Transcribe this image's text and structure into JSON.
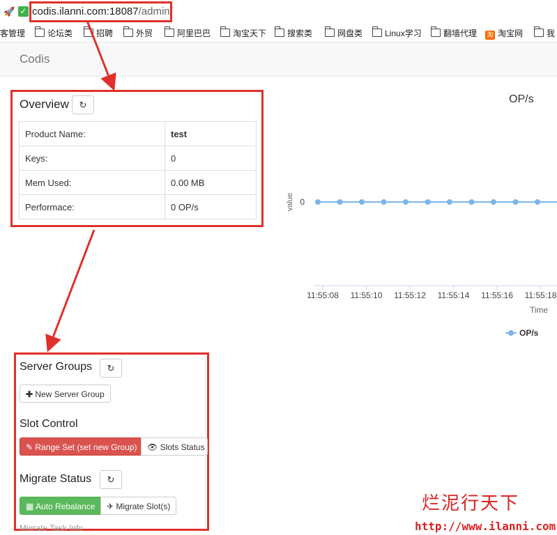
{
  "browser": {
    "url_host": "codis.ilanni.com:18087",
    "url_path": "/admin/",
    "bookmarks": [
      "客管理",
      "论坛类",
      "招聘",
      "外贸",
      "阿里巴巴",
      "淘宝天下",
      "搜索类",
      "网盘类",
      "Linux学习",
      "翻墙代理",
      "淘宝网",
      "我"
    ]
  },
  "navbar": {
    "brand": "Codis"
  },
  "overview": {
    "title": "Overview",
    "refresh_icon": "refresh-icon",
    "rows": [
      {
        "label": "Product Name:",
        "value": "test"
      },
      {
        "label": "Keys:",
        "value": "0"
      },
      {
        "label": "Mem Used:",
        "value": "0.00 MB"
      },
      {
        "label": "Performace:",
        "value": "0 OP/s"
      }
    ]
  },
  "server_groups": {
    "title": "Server Groups",
    "new_button": "New Server Group"
  },
  "slot_control": {
    "title": "Slot Control",
    "range_set_button": "Range Set (set new Group)",
    "slots_status_button": "Slots Status"
  },
  "migrate_status": {
    "title": "Migrate Status",
    "auto_rebalance_button": "Auto Rebalance",
    "migrate_slots_button": "Migrate Slot(s)",
    "task_info": "Migrate Task Info"
  },
  "chart_data": {
    "type": "line",
    "title": "OP/s",
    "xlabel": "Time",
    "ylabel": "value",
    "x": [
      "11:55:08",
      "11:55:10",
      "11:55:12",
      "11:55:14",
      "11:55:16",
      "11:55:18"
    ],
    "y_ticks": [
      "0"
    ],
    "series": [
      {
        "name": "OP/s",
        "values": [
          0,
          0,
          0,
          0,
          0,
          0,
          0,
          0,
          0,
          0,
          0,
          0
        ],
        "color": "#7cb5ec"
      }
    ]
  },
  "watermark": {
    "line1": "烂泥行天下",
    "line2": "http://www.ilanni.com"
  },
  "colors": {
    "annotation": "#e0302a",
    "danger": "#d9534f",
    "success": "#5cb85c",
    "series": "#7cb5ec"
  }
}
